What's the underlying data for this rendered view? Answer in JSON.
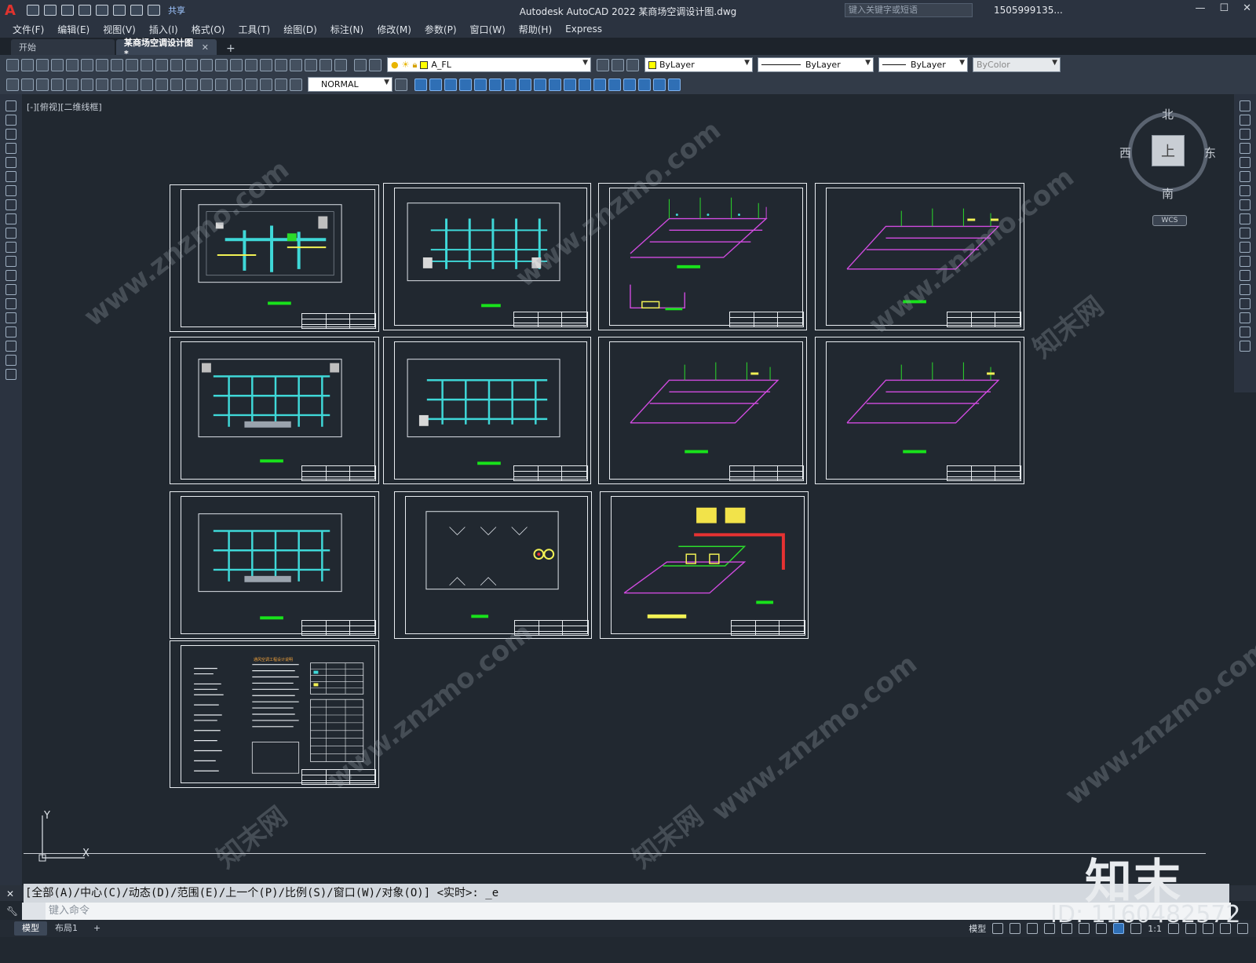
{
  "app": {
    "logo": "A",
    "title": "Autodesk AutoCAD 2022    某商场空调设计图.dwg",
    "share_label": "共享",
    "search_placeholder": "键入关键字或短语",
    "user": "1505999135...",
    "window_controls": [
      "—",
      "☐",
      "✕"
    ]
  },
  "menu": [
    "文件(F)",
    "编辑(E)",
    "视图(V)",
    "插入(I)",
    "格式(O)",
    "工具(T)",
    "绘图(D)",
    "标注(N)",
    "修改(M)",
    "参数(P)",
    "窗口(W)",
    "帮助(H)",
    "Express"
  ],
  "tabs": [
    {
      "label": "开始",
      "active": false
    },
    {
      "label": "某商场空调设计图*",
      "active": true
    }
  ],
  "toolbar": {
    "layer": "A_FL",
    "color": "ByLayer",
    "linetype": "ByLayer",
    "lineweight": "ByLayer",
    "plotstyle": "ByColor",
    "dimstyle": "NORMAL"
  },
  "viewport_label": "[-][俯视][二维线框]",
  "viewcube": {
    "north": "北",
    "south": "南",
    "west": "西",
    "east": "东",
    "face": "上",
    "wcs": "WCS"
  },
  "ucs": {
    "y": "Y",
    "x": "X"
  },
  "command": {
    "history": "[全部(A)/中心(C)/动态(D)/范围(E)/上一个(P)/比例(S)/窗口(W)/对象(O)] <实时>: _e",
    "placeholder": "键入命令"
  },
  "layout_tabs": [
    "模型",
    "布局1"
  ],
  "status": {
    "model": "模型",
    "scale": "1:1"
  },
  "sheet_note_title": "通风空调工程设计说明",
  "watermark": {
    "text": "www.znzmo.com",
    "brand": "知末网",
    "footer_brand": "知末",
    "id": "ID: 1160482572"
  }
}
